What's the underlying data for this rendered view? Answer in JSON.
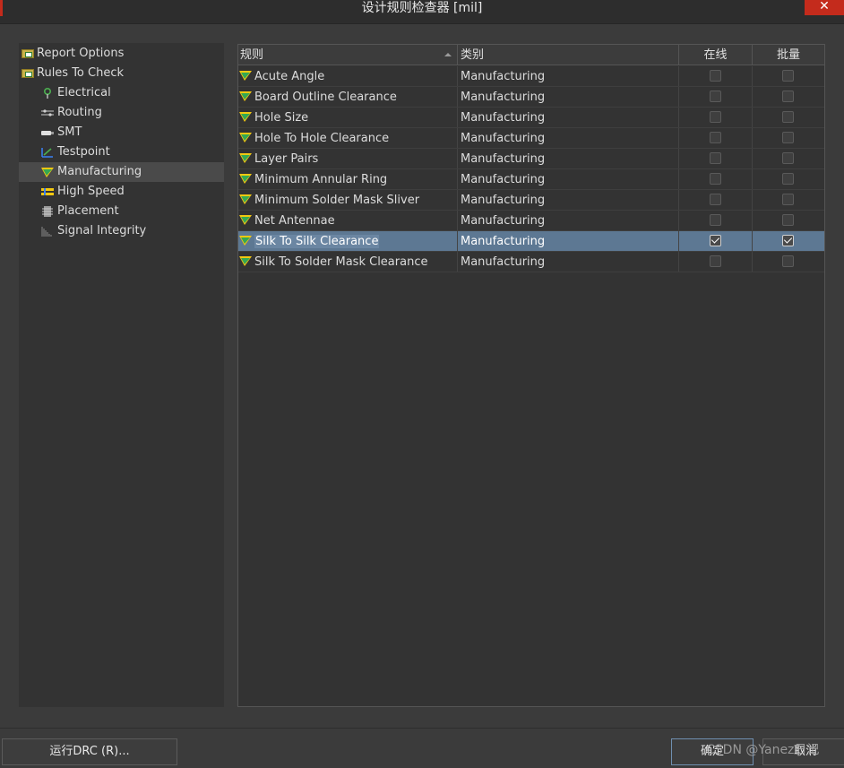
{
  "window": {
    "title": "设计规则检查器 [mil]",
    "close_glyph": "✕"
  },
  "tree": {
    "items": [
      {
        "label": "Report Options",
        "icon": "folder-icon"
      },
      {
        "label": "Rules To Check",
        "icon": "folder-icon"
      },
      {
        "label": "Electrical",
        "icon": "electrical-icon"
      },
      {
        "label": "Routing",
        "icon": "routing-icon"
      },
      {
        "label": "SMT",
        "icon": "smt-icon"
      },
      {
        "label": "Testpoint",
        "icon": "testpoint-icon"
      },
      {
        "label": "Manufacturing",
        "icon": "manufacturing-icon",
        "selected": true
      },
      {
        "label": "High Speed",
        "icon": "high-speed-icon"
      },
      {
        "label": "Placement",
        "icon": "placement-icon"
      },
      {
        "label": "Signal Integrity",
        "icon": "signal-integrity-icon"
      }
    ]
  },
  "grid": {
    "columns": [
      "规则",
      "类别",
      "在线",
      "批量"
    ],
    "rows": [
      {
        "name": "Acute Angle",
        "category": "Manufacturing",
        "online": false,
        "batch": false
      },
      {
        "name": "Board Outline Clearance",
        "category": "Manufacturing",
        "online": false,
        "batch": false
      },
      {
        "name": "Hole Size",
        "category": "Manufacturing",
        "online": false,
        "batch": false
      },
      {
        "name": "Hole To Hole Clearance",
        "category": "Manufacturing",
        "online": false,
        "batch": false
      },
      {
        "name": "Layer Pairs",
        "category": "Manufacturing",
        "online": false,
        "batch": false
      },
      {
        "name": "Minimum Annular Ring",
        "category": "Manufacturing",
        "online": false,
        "batch": false
      },
      {
        "name": "Minimum Solder Mask Sliver",
        "category": "Manufacturing",
        "online": false,
        "batch": false
      },
      {
        "name": "Net Antennae",
        "category": "Manufacturing",
        "online": false,
        "batch": false
      },
      {
        "name": "Silk To Silk Clearance",
        "category": "Manufacturing",
        "online": true,
        "batch": true,
        "selected": true
      },
      {
        "name": "Silk To Solder Mask Clearance",
        "category": "Manufacturing",
        "online": false,
        "batch": false
      }
    ]
  },
  "buttons": {
    "run_drc": "运行DRC (R)...",
    "ok": "确定",
    "cancel": "取消"
  },
  "watermark": "CSDN @Yanez日记",
  "colors": {
    "selection": "#5d7893",
    "close": "#c42b1c",
    "rule_icon_green": "#34a853",
    "rule_icon_yellow": "#f2c811"
  }
}
